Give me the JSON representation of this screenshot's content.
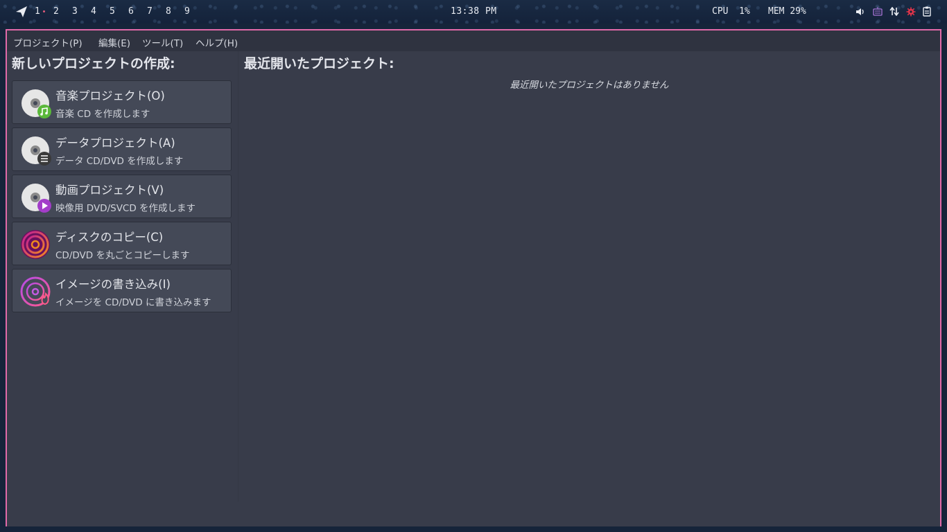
{
  "topbar": {
    "workspaces": [
      "1",
      "2",
      "3",
      "4",
      "5",
      "6",
      "7",
      "8",
      "9"
    ],
    "clock": "13:38 PM",
    "cpu_label": "CPU",
    "cpu_value": "1%",
    "mem_label": "MEM",
    "mem_value": "29%",
    "tray_icons": [
      "volume-icon",
      "keyboard-icon",
      "network-updown-icon",
      "settings-bug-icon",
      "clipboard-icon"
    ]
  },
  "menubar": {
    "items": [
      "プロジェクト(P)",
      "編集(E)",
      "ツール(T)",
      "ヘルプ(H)"
    ]
  },
  "new_project": {
    "title": "新しいプロジェクトの作成:",
    "items": [
      {
        "title": "音楽プロジェクト(O)",
        "subtitle": "音楽 CD を作成します",
        "icon": "audio-cd-icon"
      },
      {
        "title": "データプロジェクト(A)",
        "subtitle": "データ CD/DVD を作成します",
        "icon": "data-disc-icon"
      },
      {
        "title": "動画プロジェクト(V)",
        "subtitle": "映像用 DVD/SVCD を作成します",
        "icon": "video-disc-icon"
      },
      {
        "title": "ディスクのコピー(C)",
        "subtitle": "CD/DVD を丸ごとコピーします",
        "icon": "disc-copy-icon"
      },
      {
        "title": "イメージの書き込み(I)",
        "subtitle": "イメージを CD/DVD に書き込みます",
        "icon": "burn-image-icon"
      }
    ]
  },
  "recent": {
    "title": "最近開いたプロジェクト:",
    "empty_message": "最近開いたプロジェクトはありません"
  },
  "colors": {
    "window_border": "#e26aa9",
    "window_bg": "#383c4a",
    "card_bg": "#444957",
    "audio_badge": "#5ab83a",
    "video_badge": "#a33dc9"
  }
}
